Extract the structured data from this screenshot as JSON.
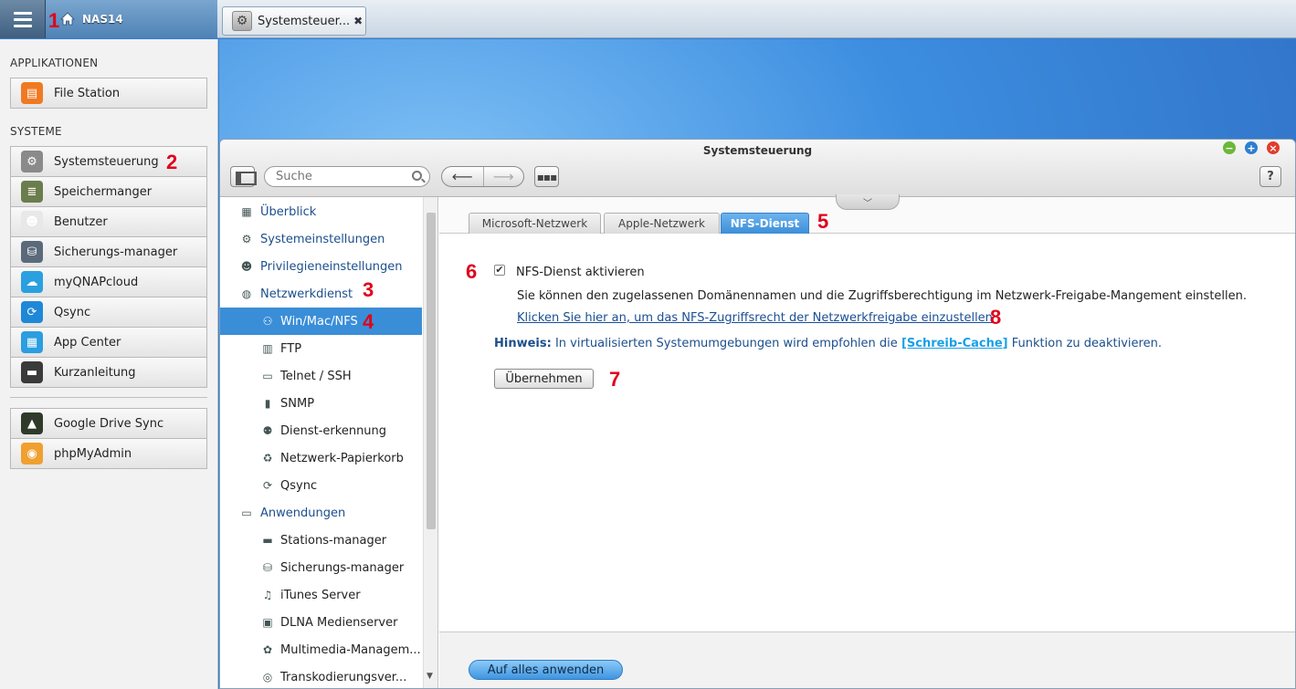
{
  "topbar": {
    "nas_name": "NAS14",
    "task_tab_label": "Systemsteuer...",
    "task_tab_close": "✖"
  },
  "annotations": [
    "1",
    "2",
    "3",
    "4",
    "5",
    "6",
    "7",
    "8"
  ],
  "left_panel": {
    "applications_title": "APPLIKATIONEN",
    "applications": [
      {
        "label": "File Station",
        "icon": "folder-icon",
        "color": "#f07a22"
      }
    ],
    "systems_title": "SYSTEME",
    "systems": [
      {
        "label": "Systemsteuerung",
        "icon": "gear-icon",
        "color": "#8a8a8a"
      },
      {
        "label": "Speichermanger",
        "icon": "storage-icon",
        "color": "#6b7d4c"
      },
      {
        "label": "Benutzer",
        "icon": "user-icon",
        "color": "#e8e8e8"
      },
      {
        "label": "Sicherungs-manager",
        "icon": "backup-icon",
        "color": "#5a6a7a"
      },
      {
        "label": "myQNAPcloud",
        "icon": "cloud-icon",
        "color": "#2aa0e0"
      },
      {
        "label": "Qsync",
        "icon": "sync-icon",
        "color": "#1e88d8"
      },
      {
        "label": "App Center",
        "icon": "grid-icon",
        "color": "#2a9ee0"
      },
      {
        "label": "Kurzanleitung",
        "icon": "guide-icon",
        "color": "#3a3a3a"
      }
    ],
    "extra_apps": [
      {
        "label": "Google Drive Sync",
        "icon": "drive-icon",
        "color": "#2f3a2a"
      },
      {
        "label": "phpMyAdmin",
        "icon": "database-icon",
        "color": "#f0a030"
      }
    ]
  },
  "window": {
    "title": "Systemsteuerung",
    "search_placeholder": "Suche",
    "help_label": "?"
  },
  "nav_tree": [
    {
      "label": "Überblick",
      "icon": "overview-icon",
      "sub": false,
      "active": false
    },
    {
      "label": "Systemeinstellungen",
      "icon": "gear-icon",
      "sub": false,
      "active": false
    },
    {
      "label": "Privilegieneinstellungen",
      "icon": "user-icon",
      "sub": false,
      "active": false
    },
    {
      "label": "Netzwerkdienst",
      "icon": "globe-icon",
      "sub": false,
      "active": false
    },
    {
      "label": "Win/Mac/NFS",
      "icon": "network-icon",
      "sub": true,
      "active": true
    },
    {
      "label": "FTP",
      "icon": "ftp-icon",
      "sub": true,
      "active": false
    },
    {
      "label": "Telnet / SSH",
      "icon": "terminal-icon",
      "sub": true,
      "active": false
    },
    {
      "label": "SNMP",
      "icon": "chart-icon",
      "sub": true,
      "active": false
    },
    {
      "label": "Dienst-erkennung",
      "icon": "discovery-icon",
      "sub": true,
      "active": false
    },
    {
      "label": "Netzwerk-Papierkorb",
      "icon": "recycle-icon",
      "sub": true,
      "active": false
    },
    {
      "label": "Qsync",
      "icon": "sync-icon",
      "sub": true,
      "active": false
    },
    {
      "label": "Anwendungen",
      "icon": "tray-icon",
      "sub": false,
      "active": false
    },
    {
      "label": "Stations-manager",
      "icon": "station-icon",
      "sub": true,
      "active": false
    },
    {
      "label": "Sicherungs-manager",
      "icon": "backup-icon",
      "sub": true,
      "active": false
    },
    {
      "label": "iTunes Server",
      "icon": "music-icon",
      "sub": true,
      "active": false
    },
    {
      "label": "DLNA Medienserver",
      "icon": "media-icon",
      "sub": true,
      "active": false
    },
    {
      "label": "Multimedia-Managem...",
      "icon": "multimedia-icon",
      "sub": true,
      "active": false
    },
    {
      "label": "Transkodierungsver...",
      "icon": "transcode-icon",
      "sub": true,
      "active": false
    }
  ],
  "tabs": [
    {
      "label": "Microsoft-Netzwerk",
      "active": false
    },
    {
      "label": "Apple-Netzwerk",
      "active": false
    },
    {
      "label": "NFS-Dienst",
      "active": true
    }
  ],
  "form": {
    "checkbox_label": "NFS-Dienst aktivieren",
    "checkbox_checked": true,
    "description": "Sie können den zugelassenen Domänennamen und die Zugriffsberechtigung im Netzwerk-Freigabe-Mangement einstellen.",
    "link": "Klicken Sie hier an, um das NFS-Zugriffsrecht der Netzwerkfreigabe einzustellen",
    "hint_label": "Hinweis:",
    "hint_text_1": "In virtualisierten Systemumgebungen wird empfohlen die",
    "hint_link": "[Schreib-Cache]",
    "hint_text_2": "Funktion zu deaktivieren.",
    "apply_label": "Übernehmen"
  },
  "footer": {
    "apply_all_label": "Auf alles anwenden"
  }
}
